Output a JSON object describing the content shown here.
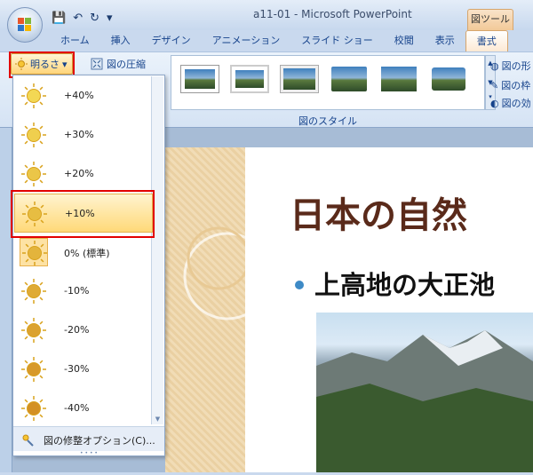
{
  "window": {
    "title": "a11-01 - Microsoft PowerPoint",
    "tool_context": "図ツール"
  },
  "tabs": [
    "ホーム",
    "挿入",
    "デザイン",
    "アニメーション",
    "スライド ショー",
    "校閲",
    "表示",
    "書式"
  ],
  "ribbon": {
    "brightness_label": "明るさ",
    "compress_label": "図の圧縮",
    "style_group_label": "図のスタイル",
    "right_items": [
      "図の形",
      "図の枠",
      "図の効"
    ]
  },
  "dropdown": {
    "items": [
      {
        "label": "+40%",
        "level": 0.9
      },
      {
        "label": "+30%",
        "level": 0.8
      },
      {
        "label": "+20%",
        "level": 0.7
      },
      {
        "label": "+10%",
        "level": 0.6
      },
      {
        "label": "0% (標準)",
        "level": 0.5
      },
      {
        "label": "-10%",
        "level": 0.4
      },
      {
        "label": "-20%",
        "level": 0.3
      },
      {
        "label": "-30%",
        "level": 0.2
      },
      {
        "label": "-40%",
        "level": 0.1
      }
    ],
    "footer_label": "図の修整オプション(C)..."
  },
  "slide": {
    "title": "日本の自然",
    "bullet": "上高地の大正池"
  },
  "colors": {
    "accent_red": "#e20000",
    "title_brown": "#5a2a1a",
    "bullet_blue": "#3e8ac6"
  }
}
